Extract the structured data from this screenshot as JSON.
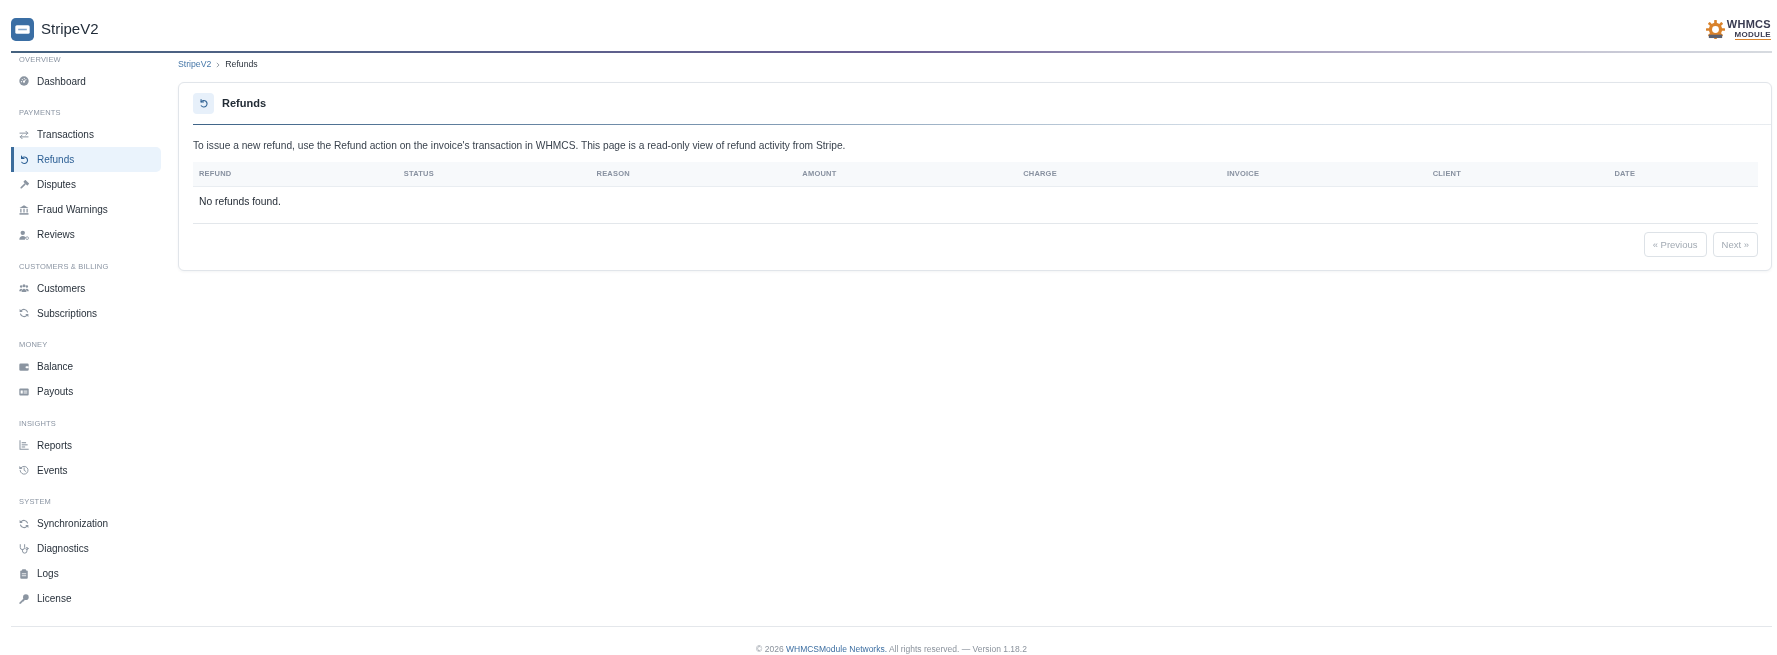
{
  "header": {
    "app_name": "StripeV2",
    "brand": {
      "name": "WHMCS",
      "tagline": "MODULE"
    }
  },
  "sidebar": {
    "sections": [
      {
        "label": "OVERVIEW",
        "items": [
          {
            "label": "Dashboard",
            "selected": false
          }
        ]
      },
      {
        "label": "PAYMENTS",
        "items": [
          {
            "label": "Transactions",
            "selected": false
          },
          {
            "label": "Refunds",
            "selected": true
          },
          {
            "label": "Disputes",
            "selected": false
          },
          {
            "label": "Fraud Warnings",
            "selected": false
          },
          {
            "label": "Reviews",
            "selected": false
          }
        ]
      },
      {
        "label": "CUSTOMERS & BILLING",
        "items": [
          {
            "label": "Customers",
            "selected": false
          },
          {
            "label": "Subscriptions",
            "selected": false
          }
        ]
      },
      {
        "label": "MONEY",
        "items": [
          {
            "label": "Balance",
            "selected": false
          },
          {
            "label": "Payouts",
            "selected": false
          }
        ]
      },
      {
        "label": "INSIGHTS",
        "items": [
          {
            "label": "Reports",
            "selected": false
          },
          {
            "label": "Events",
            "selected": false
          }
        ]
      },
      {
        "label": "SYSTEM",
        "items": [
          {
            "label": "Synchronization",
            "selected": false
          },
          {
            "label": "Diagnostics",
            "selected": false
          },
          {
            "label": "Logs",
            "selected": false
          },
          {
            "label": "License",
            "selected": false
          }
        ]
      }
    ]
  },
  "breadcrumb": [
    {
      "label": "StripeV2",
      "current": false
    },
    {
      "label": "Refunds",
      "current": true
    }
  ],
  "card": {
    "title": "Refunds",
    "description": "To issue a new refund, use the Refund action on the invoice's transaction in WHMCS. This page is a read-only view of refund activity from Stripe.",
    "table": {
      "columns": [
        "REFUND",
        "STATUS",
        "REASON",
        "AMOUNT",
        "CHARGE",
        "INVOICE",
        "CLIENT",
        "DATE"
      ],
      "empty_message": "No refunds found."
    },
    "pagination": [
      {
        "label": "« Previous",
        "disabled": true
      },
      {
        "label": "Next »",
        "disabled": true
      }
    ]
  },
  "footer": {
    "prefix": "© 2026",
    "link": "WHMCSModule Networks.",
    "suffix": "All rights reserved. — Version 1.18.2"
  }
}
